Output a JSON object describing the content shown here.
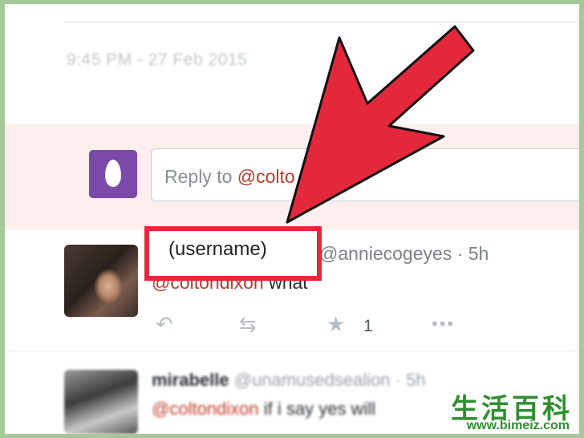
{
  "tweet_meta": {
    "timestamp": "9:45 PM - 27 Feb 2015"
  },
  "reply": {
    "placeholder_prefix": "Reply to ",
    "placeholder_mention": "@colto"
  },
  "tweets": [
    {
      "handle": "@anniecogeyes",
      "time": "· 5h",
      "mention": "@coltondixon",
      "text": " what",
      "favorites": "1"
    },
    {
      "name": "mirabelle",
      "handle": "@unamusedsealion",
      "time": "· 5h",
      "mention": "@coltondixon",
      "text": " if i say yes will"
    }
  ],
  "annotation": {
    "label": "(username)",
    "arrow_color": "#e3283c"
  },
  "icons": [
    "reply-icon",
    "retweet-icon",
    "favorite-star-icon",
    "more-options-icon"
  ],
  "watermark": {
    "chars": "生活百科",
    "url": "www.bimeiz.com"
  }
}
